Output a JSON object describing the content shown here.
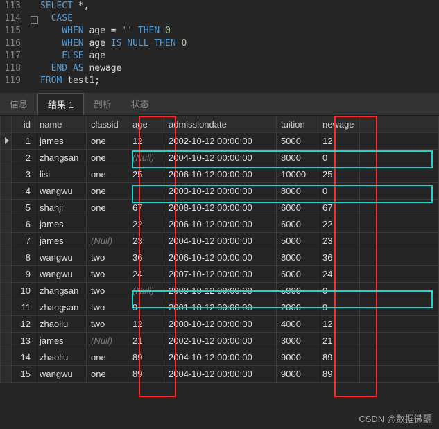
{
  "code": {
    "lines": [
      {
        "num": "113",
        "fold": "",
        "text": [
          {
            "c": "kw-blue",
            "t": "SELECT "
          },
          {
            "c": "text-norm",
            "t": "*,"
          }
        ]
      },
      {
        "num": "114",
        "fold": "[-]",
        "text": [
          {
            "c": "kw-blue",
            "t": "  CASE"
          }
        ]
      },
      {
        "num": "115",
        "fold": "",
        "text": [
          {
            "c": "kw-blue",
            "t": "    WHEN "
          },
          {
            "c": "text-norm",
            "t": "age "
          },
          {
            "c": "text-norm",
            "t": "= "
          },
          {
            "c": "text-str",
            "t": "'' "
          },
          {
            "c": "kw-blue",
            "t": "THEN "
          },
          {
            "c": "text-num",
            "t": "0"
          }
        ]
      },
      {
        "num": "116",
        "fold": "",
        "text": [
          {
            "c": "kw-blue",
            "t": "    WHEN "
          },
          {
            "c": "text-norm",
            "t": "age "
          },
          {
            "c": "kw-blue",
            "t": "IS NULL THEN "
          },
          {
            "c": "text-num",
            "t": "0"
          }
        ]
      },
      {
        "num": "117",
        "fold": "",
        "text": [
          {
            "c": "kw-blue",
            "t": "    ELSE "
          },
          {
            "c": "text-norm",
            "t": "age"
          }
        ]
      },
      {
        "num": "118",
        "fold": "",
        "text": [
          {
            "c": "kw-blue",
            "t": "  END AS "
          },
          {
            "c": "text-norm",
            "t": "newage"
          }
        ]
      },
      {
        "num": "119",
        "fold": "",
        "text": [
          {
            "c": "kw-blue",
            "t": "FROM "
          },
          {
            "c": "text-norm",
            "t": "test1;"
          }
        ]
      }
    ]
  },
  "tabs": {
    "info": "信息",
    "result": "结果 1",
    "profile": "剖析",
    "status": "状态"
  },
  "columns": {
    "id": "id",
    "name": "name",
    "classid": "classid",
    "age": "age",
    "admissiondate": "admissiondate",
    "tuition": "tuition",
    "newage": "newage"
  },
  "nullText": "(Null)",
  "rows": [
    {
      "id": "1",
      "name": "james",
      "classid": "one",
      "age": "12",
      "adm": "2002-10-12 00:00:00",
      "tuition": "5000",
      "newage": "12",
      "nameNull": false,
      "ageNull": false
    },
    {
      "id": "2",
      "name": "zhangsan",
      "classid": "one",
      "age": "",
      "adm": "2004-10-12 00:00:00",
      "tuition": "8000",
      "newage": "0",
      "nameNull": false,
      "ageNull": true
    },
    {
      "id": "3",
      "name": "lisi",
      "classid": "one",
      "age": "25",
      "adm": "2006-10-12 00:00:00",
      "tuition": "10000",
      "newage": "25",
      "nameNull": false,
      "ageNull": false
    },
    {
      "id": "4",
      "name": "wangwu",
      "classid": "one",
      "age": "",
      "adm": "2003-10-12 00:00:00",
      "tuition": "8000",
      "newage": "0",
      "nameNull": false,
      "ageNull": false
    },
    {
      "id": "5",
      "name": "shanji",
      "classid": "one",
      "age": "67",
      "adm": "2008-10-12 00:00:00",
      "tuition": "6000",
      "newage": "67",
      "nameNull": false,
      "ageNull": false
    },
    {
      "id": "6",
      "name": "james",
      "classid": "",
      "age": "22",
      "adm": "2006-10-12 00:00:00",
      "tuition": "6000",
      "newage": "22",
      "nameNull": false,
      "ageNull": false
    },
    {
      "id": "7",
      "name": "james",
      "classid": "",
      "age": "23",
      "adm": "2004-10-12 00:00:00",
      "tuition": "5000",
      "newage": "23",
      "nameNull": true,
      "ageNull": false
    },
    {
      "id": "8",
      "name": "wangwu",
      "classid": "two",
      "age": "36",
      "adm": "2006-10-12 00:00:00",
      "tuition": "8000",
      "newage": "36",
      "nameNull": false,
      "ageNull": false
    },
    {
      "id": "9",
      "name": "wangwu",
      "classid": "two",
      "age": "24",
      "adm": "2007-10-12 00:00:00",
      "tuition": "6000",
      "newage": "24",
      "nameNull": false,
      "ageNull": false
    },
    {
      "id": "10",
      "name": "zhangsan",
      "classid": "two",
      "age": "",
      "adm": "2009-10-12 00:00:00",
      "tuition": "5000",
      "newage": "0",
      "nameNull": false,
      "ageNull": true
    },
    {
      "id": "11",
      "name": "zhangsan",
      "classid": "two",
      "age": "9",
      "adm": "2001-10-12 00:00:00",
      "tuition": "2000",
      "newage": "9",
      "nameNull": false,
      "ageNull": false
    },
    {
      "id": "12",
      "name": "zhaoliu",
      "classid": "two",
      "age": "12",
      "adm": "2000-10-12 00:00:00",
      "tuition": "4000",
      "newage": "12",
      "nameNull": false,
      "ageNull": false
    },
    {
      "id": "13",
      "name": "james",
      "classid": "",
      "age": "21",
      "adm": "2002-10-12 00:00:00",
      "tuition": "3000",
      "newage": "21",
      "nameNull": true,
      "ageNull": false
    },
    {
      "id": "14",
      "name": "zhaoliu",
      "classid": "one",
      "age": "89",
      "adm": "2004-10-12 00:00:00",
      "tuition": "9000",
      "newage": "89",
      "nameNull": false,
      "ageNull": false
    },
    {
      "id": "15",
      "name": "wangwu",
      "classid": "one",
      "age": "89",
      "adm": "2004-10-12 00:00:00",
      "tuition": "9000",
      "newage": "89",
      "nameNull": false,
      "ageNull": false
    }
  ],
  "watermark": "CSDN @数据微醺"
}
